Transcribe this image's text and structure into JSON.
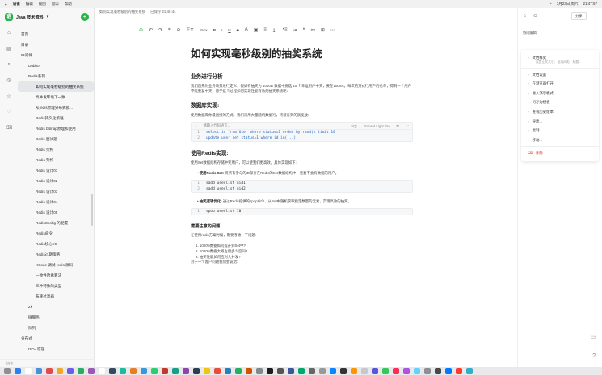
{
  "menubar": {
    "app": "语雀",
    "items": [
      "编辑",
      "视图",
      "窗口",
      "帮助"
    ],
    "time": "21:47:57",
    "date": "1月23日 周六"
  },
  "sidebar": {
    "title": "Java 技术资料",
    "items": [
      {
        "label": "首页",
        "indent": 0
      },
      {
        "label": "目录",
        "indent": 0
      },
      {
        "label": "中间件",
        "indent": 0
      },
      {
        "label": "Dubbo",
        "indent": 1
      },
      {
        "label": "Redis系列",
        "indent": 1
      },
      {
        "label": "如何实现毫秒级别的抽奖系统",
        "indent": 2,
        "active": true
      },
      {
        "label": "高并发环境下一致...",
        "indent": 2
      },
      {
        "label": "从redis原理分布式锁...",
        "indent": 2
      },
      {
        "label": "Redis持久化策略",
        "indent": 2
      },
      {
        "label": "Redis bitmap原理和使用",
        "indent": 2
      },
      {
        "label": "Redis 面试题",
        "indent": 2
      },
      {
        "label": "Redis 架构",
        "indent": 2
      },
      {
        "label": "Redis 架构",
        "indent": 2
      },
      {
        "label": "Redis 设计01",
        "indent": 2
      },
      {
        "label": "Redis 设计02",
        "indent": 2
      },
      {
        "label": "Redis 设计03",
        "indent": 2
      },
      {
        "label": "Redis 设计04",
        "indent": 2
      },
      {
        "label": "Redis 设计05",
        "indent": 2
      },
      {
        "label": "RedisConfig 的配置",
        "indent": 2
      },
      {
        "label": "Redis命令",
        "indent": 2
      },
      {
        "label": "Redis核心 IO",
        "indent": 2
      },
      {
        "label": "Redis过期策略",
        "indent": 2
      },
      {
        "label": "XCode 调试 redis 源码",
        "indent": 2
      },
      {
        "label": "一致性哈希算法",
        "indent": 2
      },
      {
        "label": "三种特殊的类型",
        "indent": 2
      },
      {
        "label": "布隆过滤器",
        "indent": 2
      },
      {
        "label": "Zk",
        "indent": 1
      },
      {
        "label": "微服务",
        "indent": 1
      },
      {
        "label": "队列",
        "indent": 1
      },
      {
        "label": "分布式",
        "indent": 0
      },
      {
        "label": "RPC 原理",
        "indent": 1
      }
    ],
    "footer": "协作"
  },
  "topbar": {
    "path": "如何实现毫秒级别的抽奖系统",
    "status": "已保存 21:46:44"
  },
  "toolbar": {
    "style": "正文",
    "size": "15px"
  },
  "doc": {
    "title": "如何实现毫秒级别的抽奖系统",
    "s1": "业务进行分析",
    "p1": "我们首先对业务场景进行定义，假如有抽奖为 1000w 数据中挑选 10 个幸运用户中奖，要在100ms，每次的方式行用户的名单，得到一个用户不能重复中奖，基于这个过程如何实现性能有效的抽奖系统呢?",
    "s2": "数据库实现:",
    "p2": "使用数据库你最直接的方式，我们采用大量随机数据行，将被有到的就发放:",
    "code1": {
      "placeholder": "请输入代码语言...",
      "lang": "SQL",
      "theme": "Sunset Light Pro",
      "lines": [
        "select id from User where status=1 order by rand() limit 10",
        "update user set status=1 where id in(...)"
      ]
    },
    "s3": "使用Redis实现:",
    "p3": "使用Set数据结构存储中奖用户，可以使我们更高效，具体实现如下:",
    "b1_title": "使用Redis Set:",
    "b1_text": "将所有参与的ID保存在Redis的Set数据结构中，重复不会有数据的用户。",
    "code2": [
      "sadd userlist uid1",
      "sadd userlist uid2"
    ],
    "b2_title": "抽奖逻辑优化:",
    "b2_text": "通过Redis提供的spop命令，从Set中随机获取指定数量的元素，实现高效的抽奖。",
    "code3": [
      "spop userlist 10"
    ],
    "s4": "需要注意的问题",
    "p4": "在使用redis方案时候，需要考虑一下问题:",
    "nums": [
      "1. 1000w数据如何提升到Set中?",
      "2. 1000w数据大概占用多少空间?",
      "3. 抽奖性能如何应对大并发?"
    ],
    "p5": "对于一个客户问题我们会说给:"
  },
  "rightpanel": {
    "share": "分享",
    "collab": "协同编辑",
    "menu": [
      {
        "label": "文档样式",
        "sub": "设置正文大小、段落间距、标题..."
      },
      {
        "label": "文档设置"
      },
      {
        "label": "在浏览器打开"
      },
      {
        "label": "进入演示模式"
      },
      {
        "label": "另存为模板"
      },
      {
        "label": "查看历史版本"
      },
      {
        "label": "导出..."
      },
      {
        "label": "复制..."
      },
      {
        "label": "移动..."
      },
      {
        "label": "删除",
        "danger": true
      }
    ]
  }
}
